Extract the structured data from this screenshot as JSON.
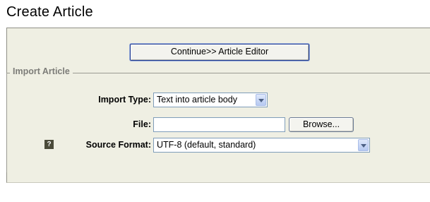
{
  "page": {
    "title": "Create Article"
  },
  "actions": {
    "continue_label": "Continue>> Article Editor"
  },
  "import": {
    "legend": "Import Article",
    "import_type_label": "Import Type:",
    "import_type_value": "Text into article body",
    "file_label": "File:",
    "file_value": "",
    "browse_label": "Browse...",
    "help_icon_glyph": "?",
    "source_format_label": "Source Format:",
    "source_format_value": "UTF-8 (default, standard)"
  }
}
